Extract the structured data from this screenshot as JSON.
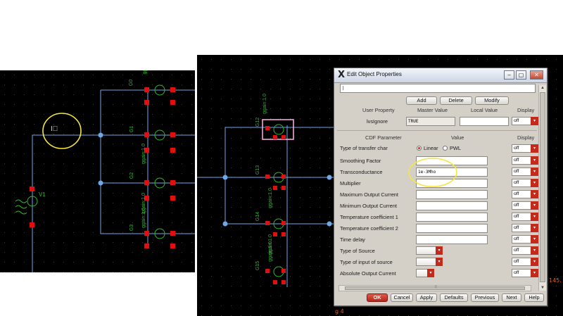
{
  "left_schematic": {
    "labels": {
      "cursor": "I⃝",
      "v1": "V1",
      "g0": "G0",
      "g0_gain": "gg",
      "g1": "G1",
      "g1_gain": "ggain:1.0",
      "g2": "G2",
      "g2_gain": "ggain:1.0",
      "g3": "G3",
      "g3_gain": "ggain:1.0"
    }
  },
  "right_schematic": {
    "labels": {
      "g12": "G12",
      "g12_gain": "ggain:1.0",
      "g13": "G13",
      "g13_gain": "ggain:1.0",
      "g14": "G14",
      "g14_gain": "ggain:1.0",
      "g15": "G15",
      "g15_gain": "ggain:1.0",
      "edge_text": "145.",
      "edge_text2": "g 4"
    }
  },
  "dialog": {
    "title": "Edit Object Properties",
    "title_icon": "X",
    "window_buttons": {
      "minimize": "‒",
      "maximize": "▢",
      "close": "✕"
    },
    "top_field_value": "|",
    "user_props": {
      "buttons": {
        "add": "Add",
        "delete": "Delete",
        "modify": "Modify"
      },
      "headers": {
        "user_property": "User Property",
        "master_value": "Master Value",
        "local_value": "Local Value",
        "display": "Display"
      },
      "row": {
        "name": "lvsIgnore",
        "master": "TRUE",
        "local": "",
        "display": "off"
      }
    },
    "cdf": {
      "headers": {
        "param": "CDF Parameter",
        "value": "Value",
        "display": "Display"
      },
      "transfer": {
        "label": "Type of transfer char",
        "opt_linear": "Linear",
        "opt_pwl": "PWL",
        "display": "off"
      },
      "rows": [
        {
          "label": "Smoothing Factor",
          "value": "",
          "display": "off"
        },
        {
          "label": "Transconductance",
          "value": "1e-3Mho",
          "display": "off"
        },
        {
          "label": "Multiplier",
          "value": "",
          "display": "off"
        },
        {
          "label": "Maximum Output Current",
          "value": "",
          "display": "off"
        },
        {
          "label": "Minimum Output Current",
          "value": "",
          "display": "off"
        },
        {
          "label": "Temperature coefficient 1",
          "value": "",
          "display": "off"
        },
        {
          "label": "Temperature coefficient 2",
          "value": "",
          "display": "off"
        },
        {
          "label": "Time delay",
          "value": "",
          "display": "off"
        }
      ],
      "selects": [
        {
          "label": "Type of Source",
          "display": "off"
        },
        {
          "label": "Type of input of source",
          "display": "off"
        },
        {
          "label": "Absolute Output Current",
          "display": "off"
        }
      ]
    },
    "footer": {
      "ok": "OK",
      "cancel": "Cancel",
      "apply": "Apply",
      "defaults": "Defaults",
      "previous": "Previous",
      "next": "Next",
      "help": "Help"
    },
    "dropdown_glyph": "▾",
    "colors": {
      "accent_red": "#c22a1c",
      "highlight": "#f5e642",
      "net_blue": "#6ea8e8",
      "pin_red": "#e01010"
    }
  }
}
